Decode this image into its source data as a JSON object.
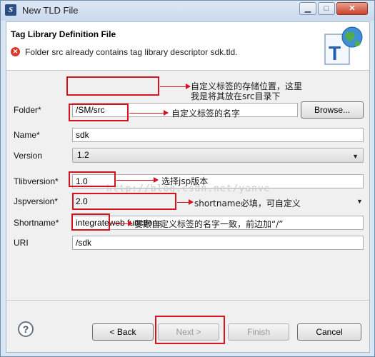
{
  "window": {
    "title": "New TLD File",
    "app_icon": "eclipse-icon",
    "min_symbol": "▁",
    "max_symbol": "□",
    "close_symbol": "✕"
  },
  "header": {
    "title": "Tag Library Definition File",
    "error_icon": "error-icon",
    "error_symbol": "✕",
    "message": "Folder src already contains tag library descriptor sdk.tld.",
    "graphic": "tld-globe-icon"
  },
  "form": {
    "folder": {
      "label": "Folder*",
      "value": "/SM/src",
      "browse": "Browse..."
    },
    "name": {
      "label": "Name*",
      "value": "sdk"
    },
    "version": {
      "label": "Version",
      "value": "1.2"
    },
    "tlibversion": {
      "label": "Tlibversion*",
      "value": "1.0"
    },
    "jspversion": {
      "label": "Jspversion*",
      "value": "2.0"
    },
    "shortname": {
      "label": "Shortname*",
      "value": "integrateweb functions"
    },
    "uri": {
      "label": "URI",
      "value": "/sdk"
    }
  },
  "annotations": {
    "folder_line1": "自定义标签的存储位置，这里",
    "folder_line2": "我是将其放在src目录下",
    "name": "自定义标签的名字",
    "jsp": "选择jsp版本",
    "shortname": "shortname必填，可自定义",
    "uri": "要跟自定义标签的名字一致，前边加“/”"
  },
  "watermark": "http://blog.csdn.net/yanve",
  "footer": {
    "help_symbol": "?",
    "back": "< Back",
    "next": "Next >",
    "finish": "Finish",
    "cancel": "Cancel"
  },
  "colors": {
    "annotation_red": "#d6131f",
    "title_bar": "#dbe6f3",
    "error": "#d83a2c"
  }
}
